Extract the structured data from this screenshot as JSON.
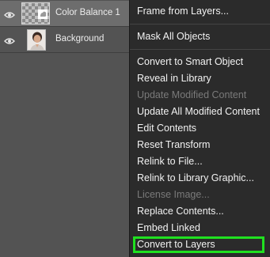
{
  "layers": [
    {
      "name": "Color Balance 1",
      "visibility_icon": "eye-icon",
      "thumbnail": "color-balance-adjustment-icon",
      "selected": true
    },
    {
      "name": "Background",
      "visibility_icon": "eye-icon",
      "thumbnail": "portrait-photo",
      "selected": false
    }
  ],
  "context_menu": {
    "items": [
      {
        "label": "Frame from Layers...",
        "enabled": true
      },
      {
        "label": "Mask All Objects",
        "enabled": true
      },
      {
        "label": "Convert to Smart Object",
        "enabled": true
      },
      {
        "label": "Reveal in Library",
        "enabled": true
      },
      {
        "label": "Update Modified Content",
        "enabled": false
      },
      {
        "label": "Update All Modified Content",
        "enabled": true
      },
      {
        "label": "Edit Contents",
        "enabled": true
      },
      {
        "label": "Reset Transform",
        "enabled": true
      },
      {
        "label": "Relink to File...",
        "enabled": true
      },
      {
        "label": "Relink to Library Graphic...",
        "enabled": true
      },
      {
        "label": "License Image...",
        "enabled": false
      },
      {
        "label": "Replace Contents...",
        "enabled": true
      },
      {
        "label": "Embed Linked",
        "enabled": true
      },
      {
        "label": "Convert to Layers",
        "enabled": true,
        "highlighted": true
      }
    ]
  },
  "colors": {
    "panel_bg": "#535353",
    "selected_row": "#6d6d6d",
    "menu_bg": "#2b2b2b",
    "menu_text": "#f2f2f2",
    "disabled_text": "#7a7a7a",
    "highlight_border": "#20e020"
  }
}
